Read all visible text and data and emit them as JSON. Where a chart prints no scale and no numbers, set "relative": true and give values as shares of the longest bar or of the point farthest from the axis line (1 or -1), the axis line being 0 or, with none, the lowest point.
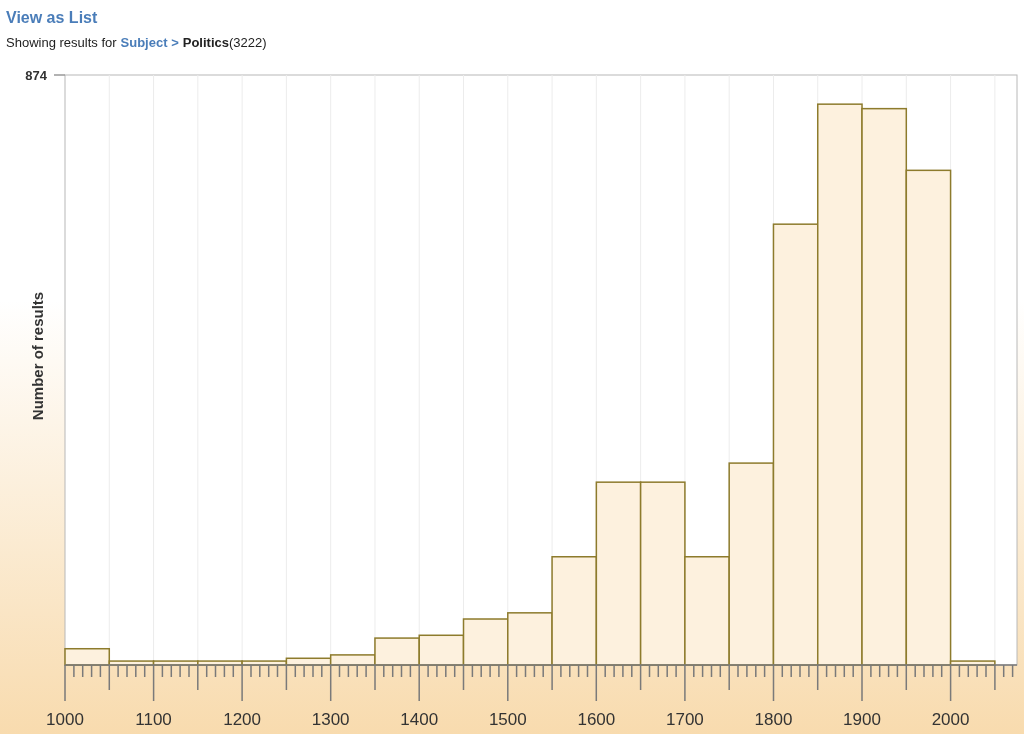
{
  "header": {
    "link": "View as List",
    "prefix": "Showing results for",
    "breadcrumb": "Subject >",
    "subject": "Politics",
    "count": "(3222)"
  },
  "chart": {
    "chart_data": {
      "type": "bar",
      "ylabel": "Number of results",
      "relative": true,
      "x": [
        1025,
        1075,
        1125,
        1175,
        1225,
        1275,
        1325,
        1375,
        1425,
        1475,
        1525,
        1575,
        1625,
        1675,
        1725,
        1775,
        1825,
        1875,
        1925,
        1975,
        2025
      ],
      "series": [
        {
          "color": "#fdf1de",
          "values": [
            0.029,
            0.007,
            0.007,
            0.007,
            0.007,
            0.012,
            0.018,
            0.048,
            0.053,
            0.082,
            0.093,
            0.193,
            0.326,
            0.326,
            0.193,
            0.36,
            0.786,
            1,
            0.992,
            0.882,
            0.007
          ]
        }
      ],
      "xlim": [
        1000,
        2075
      ],
      "xticks": [
        1000,
        1100,
        1200,
        1300,
        1400,
        1500,
        1600,
        1700,
        1800,
        1900,
        2000
      ],
      "grid": true,
      "annotations": [
        {
          "text": "874"
        }
      ]
    }
  }
}
